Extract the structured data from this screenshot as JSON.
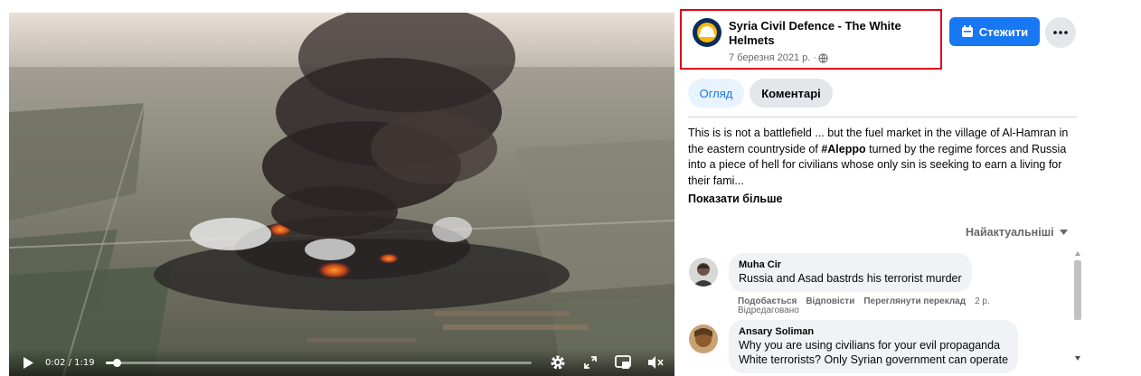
{
  "video": {
    "time_display": "0:02 / 1:19",
    "progress_fraction": 0.026
  },
  "post": {
    "page_name": "Syria Civil Defence - The White Helmets",
    "date": "7 березня 2021 р. ·",
    "follow_label": "Стежити",
    "tabs": [
      {
        "label": "Огляд",
        "active": true
      },
      {
        "label": "Коментарі",
        "active": false
      }
    ],
    "description_before": "This is is not a battlefield ... but the fuel market in the village of Al-Hamran in the eastern countryside of ",
    "description_hashtag": "#Aleppo",
    "description_after": " turned by the regime forces and Russia into a piece of hell for civilians whose only sin is seeking to earn a living for their fami...",
    "see_more": "Показати більше",
    "sort_label": "Найактуальніші"
  },
  "comments": [
    {
      "author": "Muha Cir",
      "text": "Russia and Asad bastrds his terrorist murder",
      "actions": [
        "Подобається",
        "Відповісти",
        "Переглянути переклад"
      ],
      "age": "2 р.",
      "edited": "Відредаговано"
    },
    {
      "author": "Ansary Soliman",
      "text": "Why you are using civilians for your evil propaganda",
      "text_line2": "White terrorists? Only Syrian government can operate"
    }
  ],
  "colors": {
    "accent": "#1877f2",
    "highlight_box": "#e0001b",
    "secondary_text": "#65676b"
  }
}
